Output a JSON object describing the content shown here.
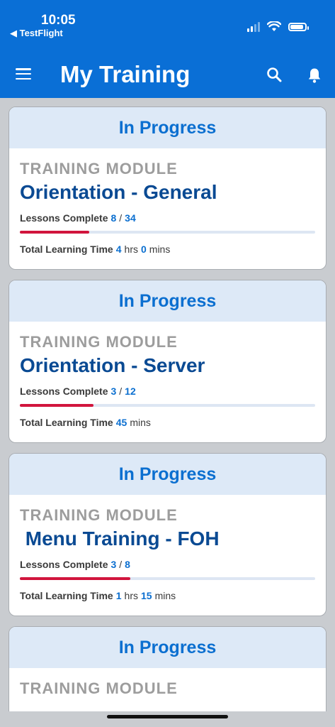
{
  "status_bar": {
    "time": "10:05",
    "back_label": "◀ TestFlight"
  },
  "header": {
    "title": "My Training",
    "menu_icon": "hamburger-menu-icon",
    "search_icon": "search-icon",
    "notifications_icon": "bell-icon"
  },
  "colors": {
    "header_bg": "#0a6fd6",
    "card_header_bg": "#dde9f7",
    "accent_blue": "#0b6fd0",
    "title_blue": "#0a4a93",
    "progress_red": "#d1153d"
  },
  "cards": [
    {
      "status": "In Progress",
      "kind": "TRAINING MODULE",
      "title": "Orientation - General",
      "lessons_label": "Lessons Complete",
      "lessons_done": "8",
      "lessons_sep": "/",
      "lessons_total": "34",
      "progress_pct": 23.5,
      "time_label": "Total Learning Time",
      "hours": "4",
      "hours_unit": "hrs",
      "mins": "0",
      "mins_unit": "mins"
    },
    {
      "status": "In Progress",
      "kind": "TRAINING MODULE",
      "title": "Orientation - Server",
      "lessons_label": "Lessons Complete",
      "lessons_done": "3",
      "lessons_sep": "/",
      "lessons_total": "12",
      "progress_pct": 25,
      "time_label": "Total Learning Time",
      "mins": "45",
      "mins_unit": "mins"
    },
    {
      "status": "In Progress",
      "kind": "TRAINING MODULE",
      "title": " Menu Training - FOH",
      "lessons_label": "Lessons Complete",
      "lessons_done": "3",
      "lessons_sep": "/",
      "lessons_total": "8",
      "progress_pct": 37.5,
      "time_label": "Total Learning Time",
      "hours": "1",
      "hours_unit": "hrs",
      "mins": "15",
      "mins_unit": "mins"
    },
    {
      "status": "In Progress",
      "kind": "TRAINING MODULE"
    }
  ]
}
